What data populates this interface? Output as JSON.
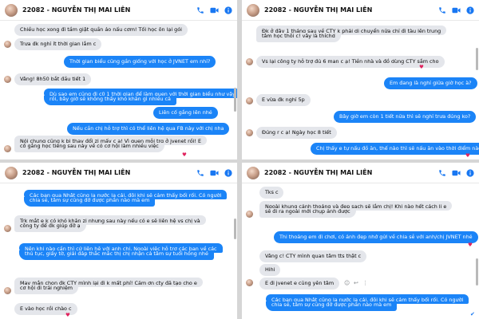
{
  "colors": {
    "accent": "#1b84f7",
    "incoming": "#e4e6eb",
    "heart": "#e0245e"
  },
  "icons": [
    "phone-icon",
    "video-icon",
    "info-icon",
    "avatar",
    "heart-reaction-icon",
    "seen-check-icon",
    "reaction-icon"
  ],
  "p1": {
    "title": "22082 - NGUYỄN THỊ MAI LIÊN",
    "msgs": [
      "Chiều học xong đi tầm giật quần áo nấu cơm! Tối học ôn lại gói",
      "Trưa đk nghỉ ít thời gian lắm c",
      "Thời gian biểu cũng gần giống với học ở JVNET em nhỉ?",
      "Vâng! 8h50 bắt đầu tiết 1",
      "Dù sao em cũng đi c0 1 thời gian để làm quen với thời gian biểu như vậy",
      "rồi, bây giờ sẽ không thấy khó khăn gì nhiều cả",
      "Liên cố gắng lên nhé",
      "Nếu cần chị hỗ trợ thì có thể liên hệ qua FB này với chị nha",
      "Nói chung cũng k bị thay đổi zi mấy c ạ! Vì quen mỗi trg ở jvenet rồi! E",
      "cố gắng học tiếng sau này về có cơ hội làm nhiều việc"
    ]
  },
  "p2": {
    "title": "22082 - NGUYỄN THỊ MAI LIÊN",
    "msgs": [
      "Đk ở đây 1 tháng sau về CTY k phải di chuyển nữa chỉ  đi tàu lên trung",
      "tâm học thôi c! vây là thíchd",
      "Vs lại công ty hỗ trợ đủ 6 man c ạ! Tiền nhà và đồ dùng CTY sắm cho",
      "Em đang là nghỉ giữa giờ học à?",
      "E vừa đk nghỉ 5p",
      "Bây giờ em còn 1 tiết nữa thì sẽ nghỉ trưa đúng ko?",
      "Đúng r c ạ! Ngày học 8 tiết",
      "Chị thấy e tự nấu đồ ăn, thế nào thì sẽ nấu ăn vào thời điểm nào?"
    ]
  },
  "p3": {
    "title": "22082 - NGUYỄN THỊ MAI LIÊN",
    "msgs": [
      "Các bạn qua Nhật cũng lạ nước lạ cái, đôi khi sẽ cảm thấy bối rối. Có người",
      "chia sẻ, tâm sự cũng đỡ được phần nào mà em",
      "Trk mắt e k có khó khăn zi nhưng sau này nếu có e sẽ liên hệ vs chị và",
      "công ty để đk giúp đỡ ạ",
      "Nên khi nào cần thì cứ liên hệ với anh chị. Ngoài việc hỗ trợ các bạn về các",
      "thủ tục, giấy tờ, giải đáp thắc mắc thị chị nhận cả tâm sự tuổi hồng nhé",
      "May mắn chọn đk CTY mình lại đi k mất phí! Cảm ơn cty đã tạo cho e",
      "cơ hội đi trải nghiệm",
      "E vào học rồi chào c"
    ]
  },
  "p4": {
    "title": "22082 - NGUYỄN THỊ MAI LIÊN",
    "msgs": [
      "Tks c",
      "Ngoài khung cảnh thoáng và đẹp sạch sẽ lắm chị! Khi nào hết cách li e",
      "sẽ đi ra ngoài mới chụp ảnh được",
      "Thi thoảng em đi chơi, có ảnh đẹp nhớ gửi về chia sẻ với anh/chị JVNET nhé",
      "Vâng c! CTY mình quan tâm tts thật c",
      "Hihi",
      "E đi jvenet e cũng yên tâm",
      "Các bạn qua Nhật cũng lạ nước lạ cái, đôi khi sẽ cảm thấy bối rối. Có người",
      "chia sẻ, tâm sự cũng đỡ được phần nào mà em"
    ]
  }
}
